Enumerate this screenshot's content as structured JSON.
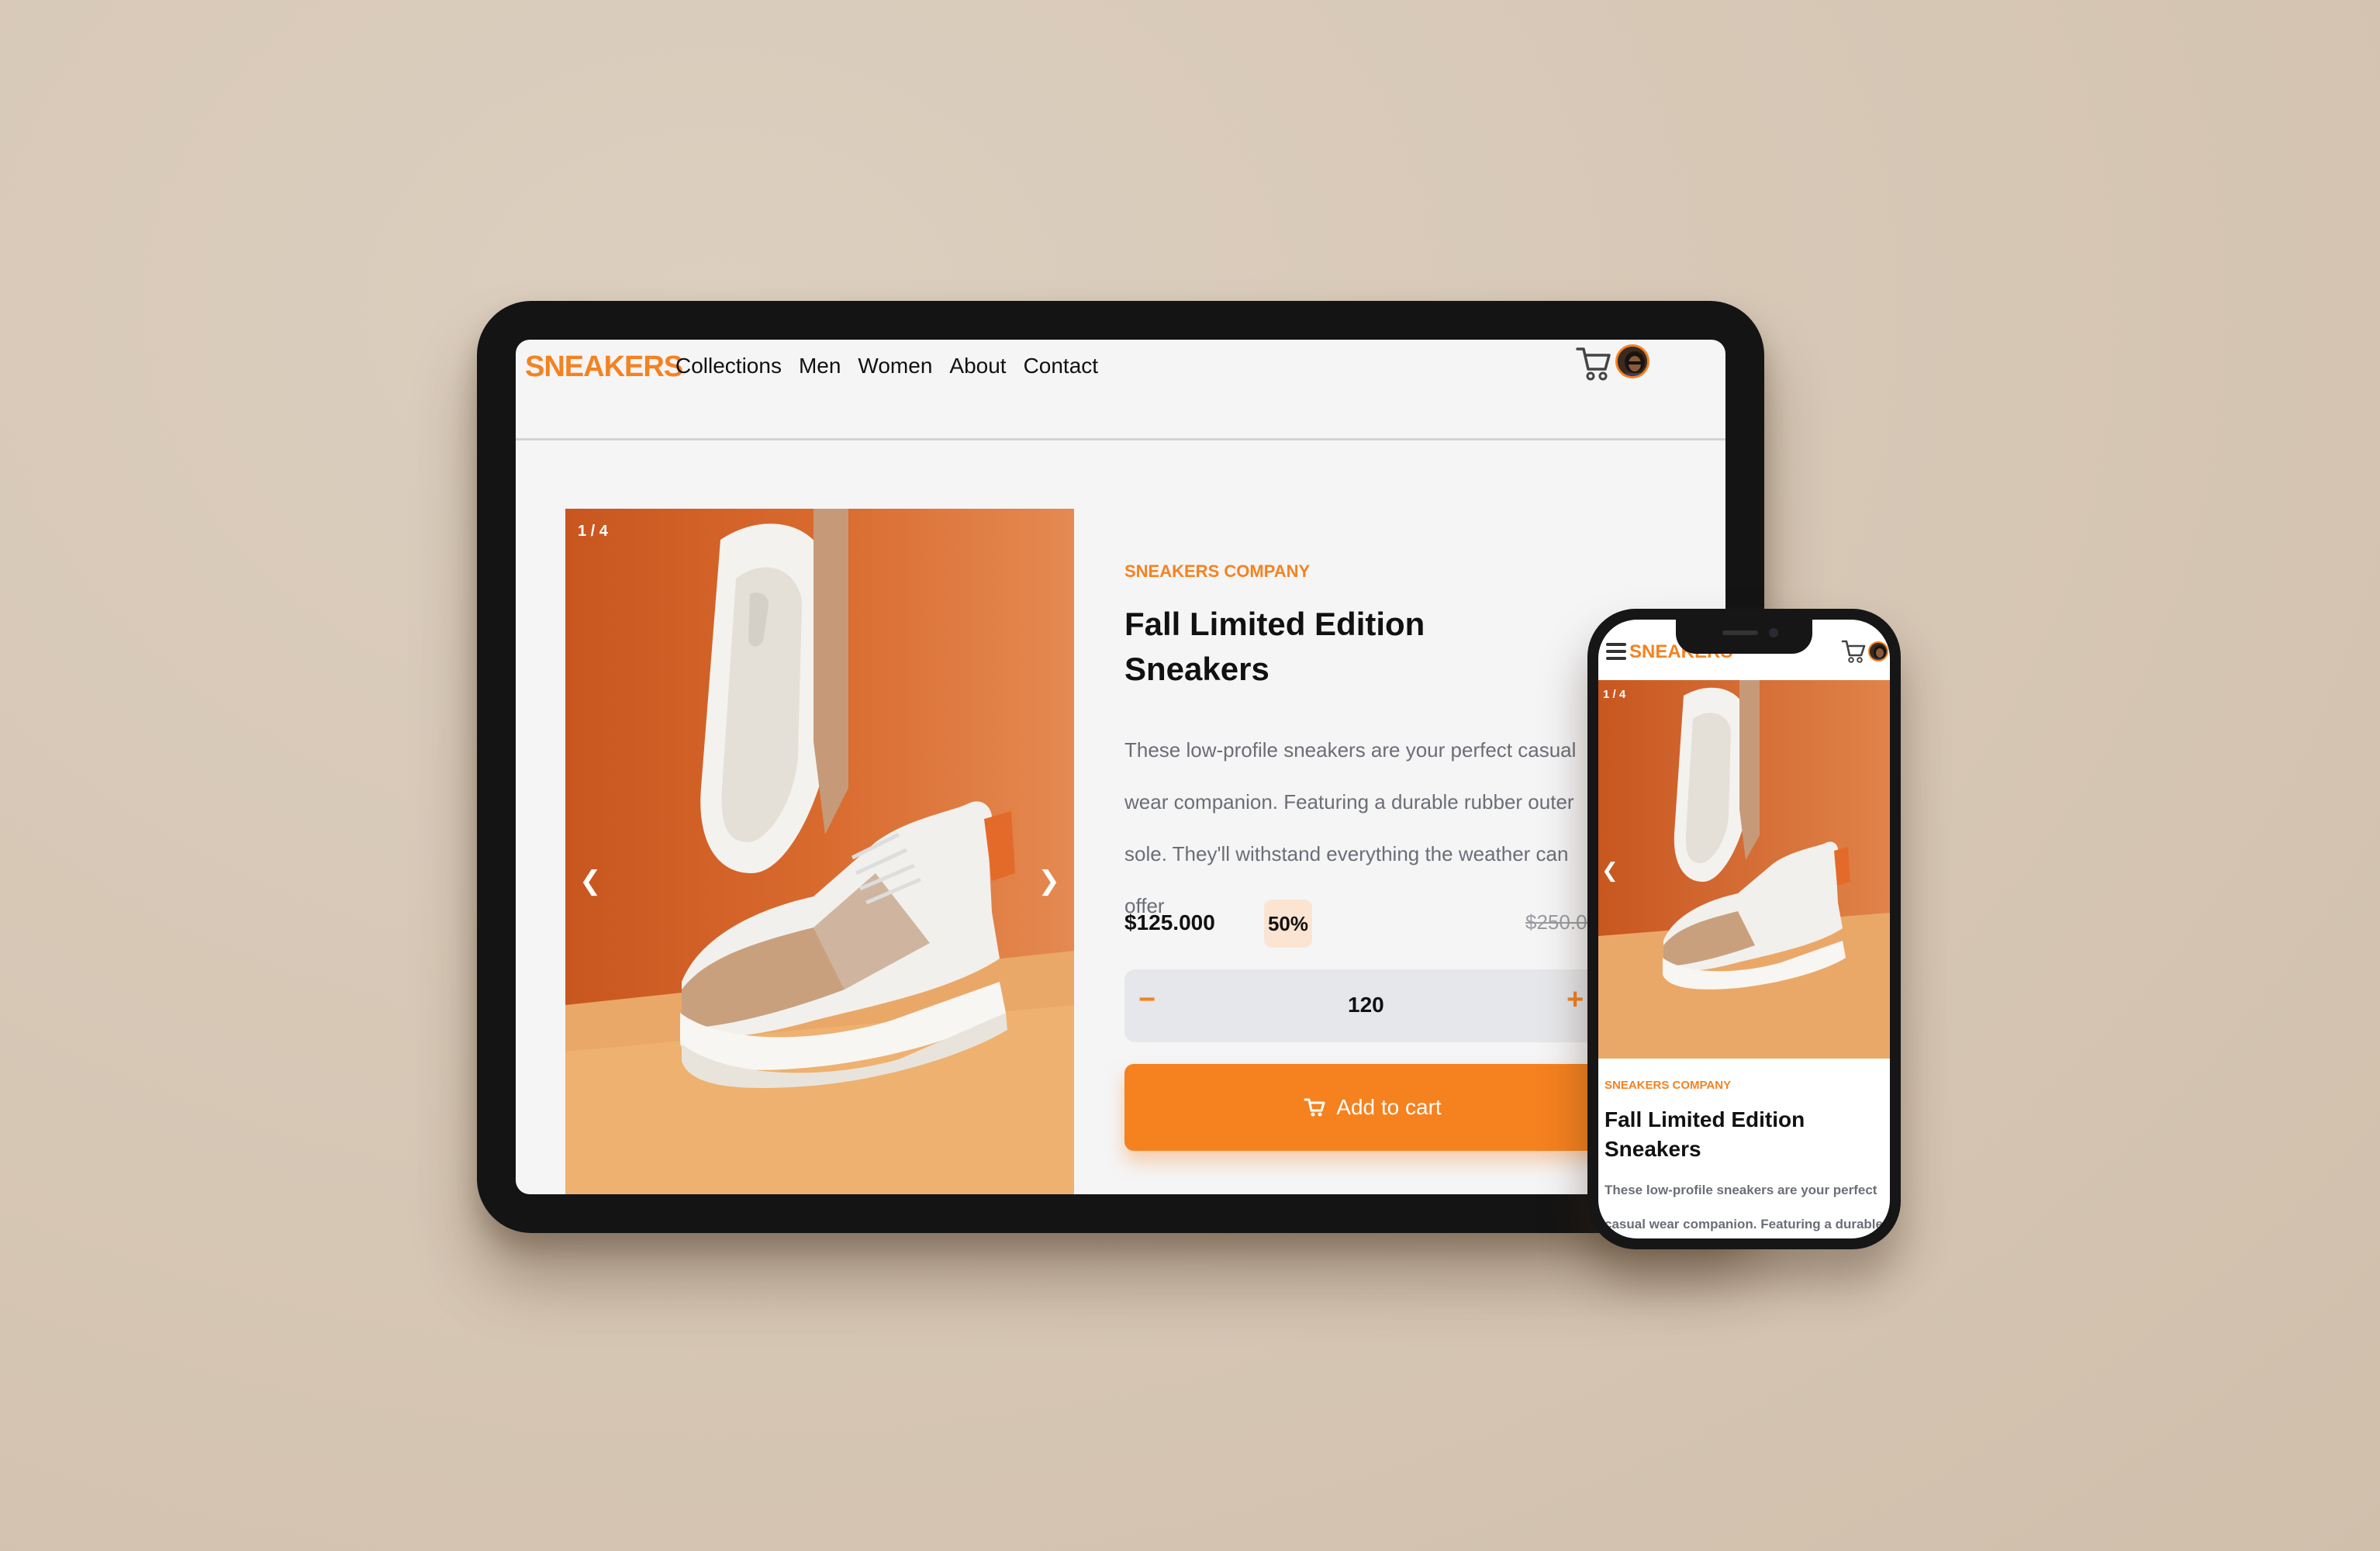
{
  "brand": {
    "logo": "SNEAKERS",
    "accent_color": "#f58220"
  },
  "nav": {
    "links": [
      "Collections",
      "Men",
      "Women",
      "About",
      "Contact"
    ],
    "cart_icon": "cart-icon",
    "avatar_icon": "avatar"
  },
  "gallery": {
    "counter": "1 / 4",
    "prev_icon": "chevron-left-icon",
    "next_icon": "chevron-right-icon"
  },
  "product": {
    "company": "SNEAKERS COMPANY",
    "title": "Fall Limited Edition Sneakers",
    "description": "These low-profile sneakers are your perfect casual wear companion. Featuring a durable rubber outer sole. They'll withstand everything the weather can offer",
    "price": "$125.000",
    "discount": "50%",
    "original_price": "$250.000"
  },
  "quantity": {
    "minus": "−",
    "value": "120",
    "plus": "+"
  },
  "add_to_cart": {
    "label": "Add to cart",
    "icon": "cart-icon"
  },
  "mobile": {
    "menu_icon": "hamburger-icon",
    "logo": "SNEAKERS",
    "counter": "1 / 4",
    "company": "SNEAKERS COMPANY",
    "title": "Fall Limited Edition Sneakers",
    "desc_line1": "These low-profile sneakers are your perfect",
    "desc_line2": "casual wear companion. Featuring a durable"
  }
}
